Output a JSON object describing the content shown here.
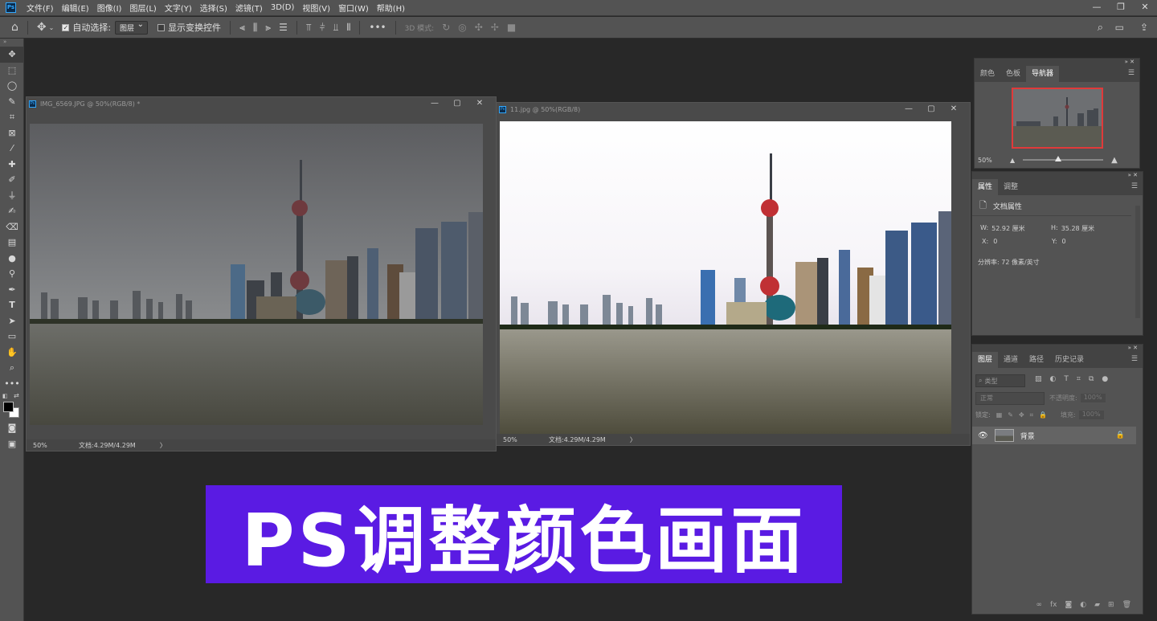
{
  "menubar": {
    "logo": "Ps",
    "items": [
      "文件(F)",
      "编辑(E)",
      "图像(I)",
      "图层(L)",
      "文字(Y)",
      "选择(S)",
      "滤镜(T)",
      "3D(D)",
      "视图(V)",
      "窗口(W)",
      "帮助(H)"
    ],
    "window_controls": [
      "—",
      "❐",
      "✕"
    ]
  },
  "options": {
    "auto_select_label": "自动选择:",
    "auto_select_value": "图层",
    "show_transform_label": "显示变换控件",
    "more": "•••",
    "mode_3d_label": "3D 模式:"
  },
  "doc1": {
    "title": "IMG_6569.JPG @ 50%(RGB/8) *",
    "zoom": "50%",
    "docsize": "文档:4.29M/4.29M",
    "arrow": "〉"
  },
  "doc2": {
    "title": "11.jpg @ 50%(RGB/8)",
    "zoom": "50%",
    "docsize": "文档:4.29M/4.29M",
    "arrow": "〉"
  },
  "navigator": {
    "tabs": [
      "颜色",
      "色板",
      "导航器"
    ],
    "zoom": "50%"
  },
  "properties": {
    "tabs": [
      "属性",
      "调整"
    ],
    "doc_label": "文档属性",
    "w_label": "W:",
    "w_value": "52.92 厘米",
    "h_label": "H:",
    "h_value": "35.28 厘米",
    "x_label": "X:",
    "x_value": "0",
    "y_label": "Y:",
    "y_value": "0",
    "resolution": "分辨率: 72 像素/英寸"
  },
  "layers": {
    "tabs": [
      "图层",
      "通道",
      "路径",
      "历史记录"
    ],
    "filter_placeholder": "类型",
    "blend_mode": "正常",
    "opacity_label": "不透明度:",
    "opacity_value": "100%",
    "lock_label": "锁定:",
    "fill_label": "填充:",
    "fill_value": "100%",
    "layer_name": "背景"
  },
  "banner": {
    "text": "PS调整颜色画面",
    "color": "#5a1be3"
  },
  "colors": {
    "ui_bg": "#535353",
    "workspace": "#282828",
    "accent_red": "#e03a3a"
  }
}
